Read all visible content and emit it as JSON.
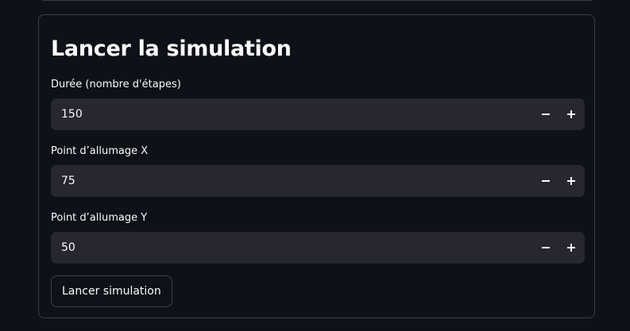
{
  "section": {
    "title": "Lancer la simulation"
  },
  "fields": [
    {
      "label": "Durée (nombre d'étapes)",
      "value": "150"
    },
    {
      "label": "Point d’allumage X",
      "value": "75"
    },
    {
      "label": "Point d’allumage Y",
      "value": "50"
    }
  ],
  "actions": {
    "run_label": "Lancer simulation"
  }
}
